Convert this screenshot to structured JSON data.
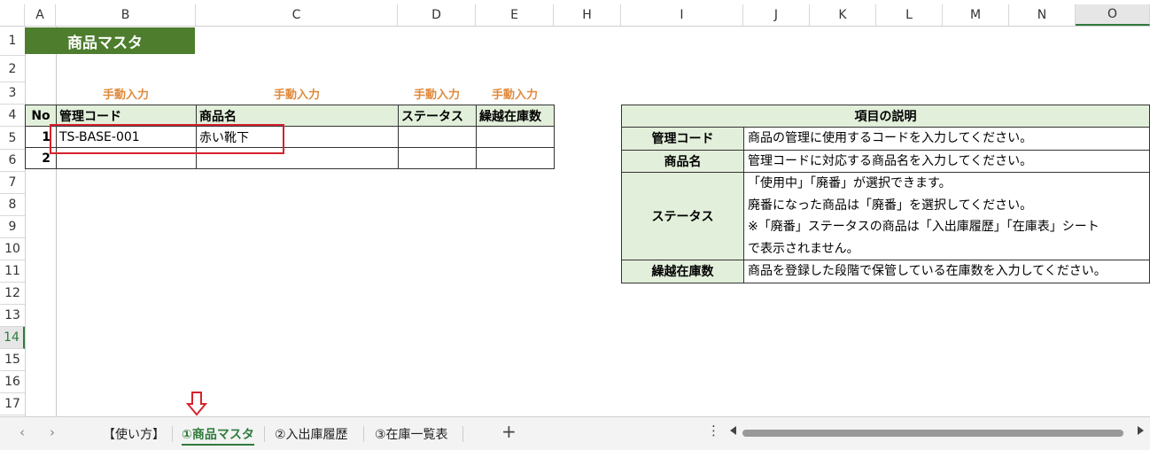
{
  "columns": [
    "A",
    "B",
    "C",
    "D",
    "E",
    "H",
    "I",
    "J",
    "K",
    "L",
    "M",
    "N",
    "O"
  ],
  "rows": [
    "1",
    "2",
    "3",
    "4",
    "5",
    "6",
    "7",
    "8",
    "9",
    "10",
    "11",
    "12",
    "13",
    "14",
    "15",
    "16",
    "17"
  ],
  "selected_column": "O",
  "selected_row": "14",
  "sheet_title": "商品マスタ",
  "hints": {
    "b": "手動入力",
    "c": "手動入力",
    "d": "手動入力",
    "e": "手動入力"
  },
  "table": {
    "headers": [
      "No",
      "管理コード",
      "商品名",
      "ステータス",
      "繰越在庫数"
    ],
    "rows": [
      {
        "no": "1",
        "code": "TS-BASE-001",
        "name": "赤い靴下",
        "status": "",
        "stock": ""
      },
      {
        "no": "2",
        "code": "",
        "name": "",
        "status": "",
        "stock": ""
      }
    ]
  },
  "description": {
    "title": "項目の説明",
    "items": [
      {
        "label": "管理コード",
        "lines": [
          "商品の管理に使用するコードを入力してください。"
        ]
      },
      {
        "label": "商品名",
        "lines": [
          "管理コードに対応する商品名を入力してください。"
        ]
      },
      {
        "label": "ステータス",
        "lines": [
          "「使用中」「廃番」が選択できます。",
          "廃番になった商品は「廃番」を選択してください。",
          "※「廃番」ステータスの商品は「入出庫履歴」「在庫表」シート",
          "で表示されません。"
        ]
      },
      {
        "label": "繰越在庫数",
        "lines": [
          "商品を登録した段階で保管している在庫数を入力してください。"
        ]
      }
    ]
  },
  "tabs": [
    "【使い方】",
    "①商品マスタ",
    "②入出庫履歴",
    "③在庫一覧表"
  ],
  "active_tab": "①商品マスタ",
  "nav": {
    "prev": "‹",
    "next": "›",
    "add": "+",
    "more": "⋮"
  },
  "colors": {
    "accent": "#2f7a3c",
    "title_bg": "#4e7d2e",
    "header_bg": "#e2efda",
    "hint": "#e08a3c",
    "highlight": "#d6222c"
  }
}
